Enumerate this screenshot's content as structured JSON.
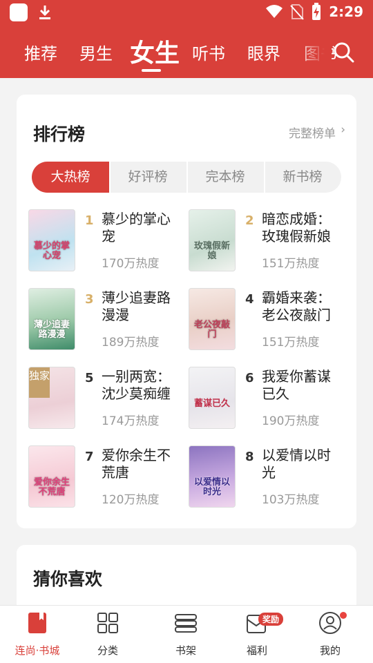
{
  "status_bar": {
    "time": "2:29"
  },
  "nav": {
    "tabs": [
      {
        "label": "推荐"
      },
      {
        "label": "男生"
      },
      {
        "label": "女生"
      },
      {
        "label": "听书"
      },
      {
        "label": "眼界"
      },
      {
        "label": "图书"
      }
    ],
    "active_index": 2
  },
  "ranking": {
    "title": "排行榜",
    "more_label": "完整榜单",
    "tabs": [
      "大热榜",
      "好评榜",
      "完本榜",
      "新书榜"
    ],
    "active_tab": 0,
    "books": [
      {
        "rank": "1",
        "name": "慕少的掌心宠",
        "heat": "170万热度",
        "cover_text": "慕少的掌心宠"
      },
      {
        "rank": "2",
        "name": "暗恋成婚：玫瑰假新娘",
        "heat": "151万热度",
        "cover_text": "玫瑰假新娘"
      },
      {
        "rank": "3",
        "name": "薄少追妻路漫漫",
        "heat": "189万热度",
        "cover_text": "薄少追妻路漫漫"
      },
      {
        "rank": "4",
        "name": "霸婚来袭：老公夜敲门",
        "heat": "151万热度",
        "cover_text": "老公夜敲门"
      },
      {
        "rank": "5",
        "name": "一别两宽：沈少莫痴缠",
        "heat": "174万热度",
        "cover_text": "",
        "badge": "独家"
      },
      {
        "rank": "6",
        "name": "我爱你蓄谋已久",
        "heat": "190万热度",
        "cover_text": "蓄谋已久"
      },
      {
        "rank": "7",
        "name": "爱你余生不荒唐",
        "heat": "120万热度",
        "cover_text": "爱你余生不荒唐"
      },
      {
        "rank": "8",
        "name": "以爱情以时光",
        "heat": "103万热度",
        "cover_text": "以爱情以时光"
      }
    ]
  },
  "guess": {
    "title": "猜你喜欢"
  },
  "bottom_nav": {
    "items": [
      {
        "label": "连尚·书城",
        "icon": "bookstore-icon"
      },
      {
        "label": "分类",
        "icon": "category-grid-icon"
      },
      {
        "label": "书架",
        "icon": "bookshelf-icon"
      },
      {
        "label": "福利",
        "icon": "welfare-envelope-icon",
        "badge": "奖励"
      },
      {
        "label": "我的",
        "icon": "profile-icon"
      }
    ],
    "active_index": 0
  },
  "colors": {
    "accent": "#d9403a",
    "rank_gold": "#d8b069"
  }
}
